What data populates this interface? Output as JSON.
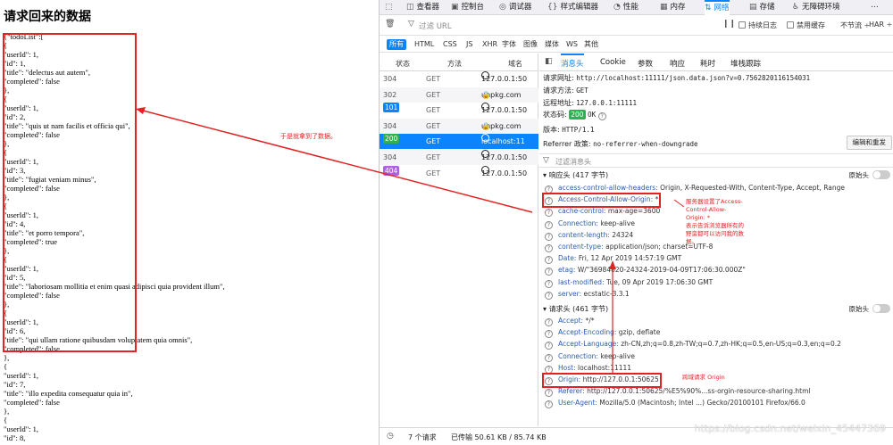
{
  "page": {
    "title": "请求回来的数据",
    "json_lines": [
      "{\"todoList\":[",
      "{",
      "\"userId\": 1,",
      "\"id\": 1,",
      "\"title\": \"delectus aut autem\",",
      "\"completed\": false",
      "},",
      "{",
      "\"userId\": 1,",
      "\"id\": 2,",
      "\"title\": \"quis ut nam facilis et officia qui\",",
      "\"completed\": false",
      "},",
      "{",
      "\"userId\": 1,",
      "\"id\": 3,",
      "\"title\": \"fugiat veniam minus\",",
      "\"completed\": false",
      "},",
      "{",
      "\"userId\": 1,",
      "\"id\": 4,",
      "\"title\": \"et porro tempora\",",
      "\"completed\": true",
      "},",
      "{",
      "\"userId\": 1,",
      "\"id\": 5,",
      "\"title\": \"laboriosam mollitia et enim quasi adipisci quia provident illum\",",
      "\"completed\": false",
      "},",
      "{",
      "\"userId\": 1,",
      "\"id\": 6,",
      "\"title\": \"qui ullam ratione quibusdam voluptatem quia omnis\",",
      "\"completed\": false",
      "},",
      "{",
      "\"userId\": 1,",
      "\"id\": 7,",
      "\"title\": \"illo expedita consequatur quia in\",",
      "\"completed\": false",
      "},",
      "{",
      "\"userId\": 1,",
      "\"id\": 8,"
    ],
    "annotation": "于是就拿到了数据。"
  },
  "devtools": {
    "tabs": [
      {
        "label": "",
        "icon": "inspector-pick-icon"
      },
      {
        "label": "查看器",
        "icon": "inspector-icon"
      },
      {
        "label": "控制台",
        "icon": "console-icon"
      },
      {
        "label": "调试器",
        "icon": "debugger-icon"
      },
      {
        "label": "样式编辑器",
        "icon": "style-editor-icon"
      },
      {
        "label": "性能",
        "icon": "performance-icon"
      },
      {
        "label": "内存",
        "icon": "memory-icon"
      },
      {
        "label": "网络",
        "icon": "network-icon",
        "active": true
      },
      {
        "label": "存储",
        "icon": "storage-icon"
      },
      {
        "label": "无障碍环境",
        "icon": "accessibility-icon"
      }
    ],
    "filter_placeholder": "过滤 URL",
    "persist_logs": "持续日志",
    "disable_cache": "禁用缓存",
    "throttle": "不节流 ÷",
    "har": "HAR ÷",
    "types": [
      "所有",
      "HTML",
      "CSS",
      "JS",
      "XHR",
      "字体",
      "图像",
      "媒体",
      "WS",
      "其他"
    ],
    "columns": [
      "状态",
      "方法",
      "域名"
    ],
    "requests": [
      {
        "status": "304",
        "method": "GET",
        "domain": "127.0.0.1:50",
        "icon": "globe-icon"
      },
      {
        "status": "302",
        "method": "GET",
        "domain": "unpkg.com",
        "icon": "lock-icon"
      },
      {
        "status": "101",
        "method": "GET",
        "domain": "127.0.0.1:50",
        "icon": "globe-icon",
        "badge_color": "#0a84ff"
      },
      {
        "status": "304",
        "method": "GET",
        "domain": "unpkg.com",
        "icon": "lock-icon"
      },
      {
        "status": "200",
        "method": "GET",
        "domain": "localhost:11",
        "icon": "globe-icon",
        "badge_color": "#30b050",
        "selected": true
      },
      {
        "status": "304",
        "method": "GET",
        "domain": "127.0.0.1:50",
        "icon": "globe-icon"
      },
      {
        "status": "404",
        "method": "GET",
        "domain": "127.0.0.1:50",
        "icon": "globe-icon",
        "badge_color": "#b060e0"
      }
    ],
    "detail_tabs": [
      "消息头",
      "Cookie",
      "参数",
      "响应",
      "耗时",
      "堆栈跟踪"
    ],
    "summary": {
      "url_label": "请求网址:",
      "url": "http://localhost:11111/json.data.json?v=0.7562820116154031",
      "method_label": "请求方法:",
      "method": "GET",
      "remote_label": "远程地址:",
      "remote": "127.0.0.1:11111",
      "status_label": "状态码:",
      "status_code": "200",
      "status_text": "OK",
      "version_label": "版本:",
      "version": "HTTP/1.1",
      "referrer_label": "Referrer 政策:",
      "referrer": "no-referrer-when-downgrade",
      "edit_button": "编辑和重发",
      "filter_placeholder": "过滤消息头"
    },
    "response_section": "响应头 (417 字节)",
    "request_section": "请求头 (461 字节)",
    "raw_label": "原始头",
    "response_headers": [
      {
        "k": "access-control-allow-headers:",
        "v": "Origin, X-Requested-With, Content-Type, Accept, Range"
      },
      {
        "k": "Access-Control-Allow-Origin:",
        "v": "*"
      },
      {
        "k": "cache-control:",
        "v": "max-age=3600"
      },
      {
        "k": "Connection:",
        "v": "keep-alive"
      },
      {
        "k": "content-length:",
        "v": "24324"
      },
      {
        "k": "content-type:",
        "v": "application/json; charset=UTF-8"
      },
      {
        "k": "Date:",
        "v": "Fri, 12 Apr 2019 14:57:19 GMT"
      },
      {
        "k": "etag:",
        "v": "W/\"36984820-24324-2019-04-09T17:06:30.000Z\""
      },
      {
        "k": "last-modified:",
        "v": "Tue, 09 Apr 2019 17:06:30 GMT"
      },
      {
        "k": "server:",
        "v": "ecstatic-3.3.1"
      }
    ],
    "request_headers": [
      {
        "k": "Accept:",
        "v": "*/*"
      },
      {
        "k": "Accept-Encoding:",
        "v": "gzip, deflate"
      },
      {
        "k": "Accept-Language:",
        "v": "zh-CN,zh;q=0.8,zh-TW;q=0.7,zh-HK;q=0.5,en-US;q=0.3,en;q=0.2"
      },
      {
        "k": "Connection:",
        "v": "keep-alive"
      },
      {
        "k": "Host:",
        "v": "localhost:11111"
      },
      {
        "k": "Origin:",
        "v": "http://127.0.0.1:50625"
      },
      {
        "k": "Referer:",
        "v": "http://127.0.0.1:50625/%E5%90%...ss-orgin-resource-sharing.html"
      },
      {
        "k": "User-Agent:",
        "v": "Mozilla/5.0 (Macintosh; Intel ...) Gecko/20100101 Firefox/66.0"
      }
    ],
    "annotation_acao": [
      "服务器设置了Access-",
      "Control-Allow-",
      "Origin: *",
      "表示告诉浏览器所有的",
      "野蛮都可以访问我的数",
      "据。"
    ],
    "annotation_origin": "跨域请求 Origin",
    "status_bar": {
      "requests": "7 个请求",
      "transferred": "已传输 50.61 KB / 85.74 KB"
    },
    "watermark": "https://blog.csdn.net/weixin_45447369"
  },
  "colors": {
    "accent": "#0a84ff",
    "annotation": "#e02424"
  }
}
